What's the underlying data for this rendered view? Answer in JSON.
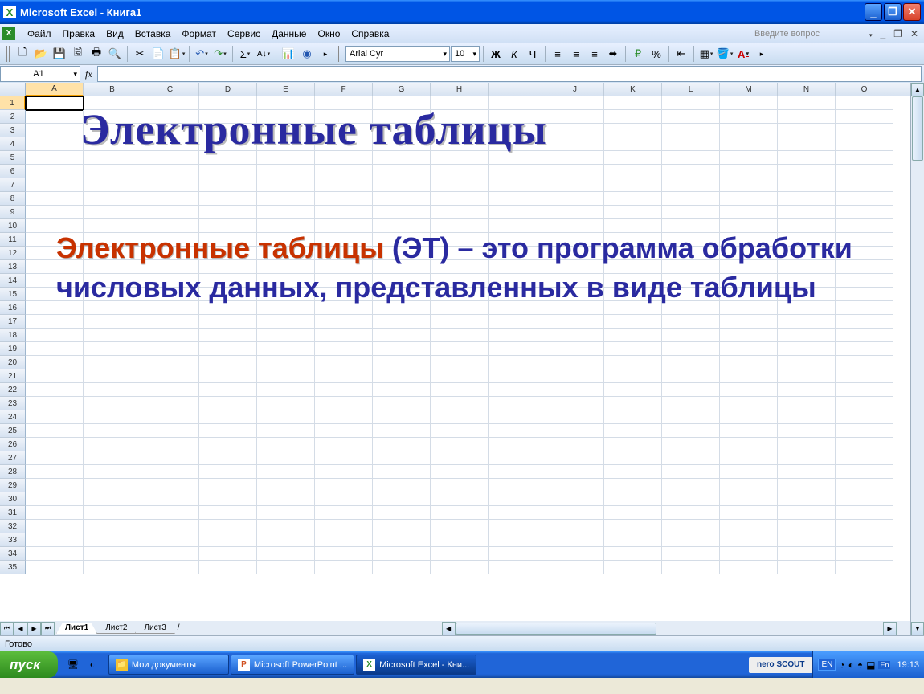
{
  "titlebar": {
    "app_name": "Microsoft Excel",
    "doc_name": "Книга1"
  },
  "menu": {
    "items": [
      "Файл",
      "Правка",
      "Вид",
      "Вставка",
      "Формат",
      "Сервис",
      "Данные",
      "Окно",
      "Справка"
    ],
    "question_placeholder": "Введите вопрос"
  },
  "toolbar1": {
    "font_name": "Arial Cyr",
    "font_size": "10"
  },
  "namebox": {
    "value": "A1",
    "fx": "fx"
  },
  "columns": [
    "A",
    "B",
    "C",
    "D",
    "E",
    "F",
    "G",
    "H",
    "I",
    "J",
    "K",
    "L",
    "M",
    "N",
    "O"
  ],
  "rows": [
    "1",
    "2",
    "3",
    "4",
    "5",
    "6",
    "7",
    "8",
    "9",
    "10",
    "11",
    "12",
    "13",
    "14",
    "15",
    "16",
    "17",
    "18",
    "19",
    "20",
    "21",
    "22",
    "23",
    "24",
    "25",
    "26",
    "27",
    "28",
    "29",
    "30",
    "31",
    "32",
    "33",
    "34",
    "35"
  ],
  "active_cell": {
    "row": "1",
    "col": "A"
  },
  "overlay": {
    "title": "Электронные таблицы",
    "body_red": "Электронные таблицы",
    "body_rest": " (ЭТ) – это программа обработки числовых данных, представленных в виде таблицы"
  },
  "sheet_tabs": {
    "active": "Лист1",
    "tabs": [
      "Лист1",
      "Лист2",
      "Лист3"
    ]
  },
  "status": {
    "text": "Готово"
  },
  "taskbar": {
    "start": "пуск",
    "apps": [
      {
        "label": "Мои документы",
        "icon": "📁",
        "ic_color": "#f4c430"
      },
      {
        "label": "Microsoft PowerPoint ...",
        "icon": "P",
        "ic_color": "#d05020"
      },
      {
        "label": "Microsoft Excel - Кни...",
        "icon": "X",
        "ic_color": "#2a8c2a",
        "active": true
      }
    ],
    "nero": "nero SCOUT",
    "lang": "EN",
    "clock": "19:13"
  }
}
